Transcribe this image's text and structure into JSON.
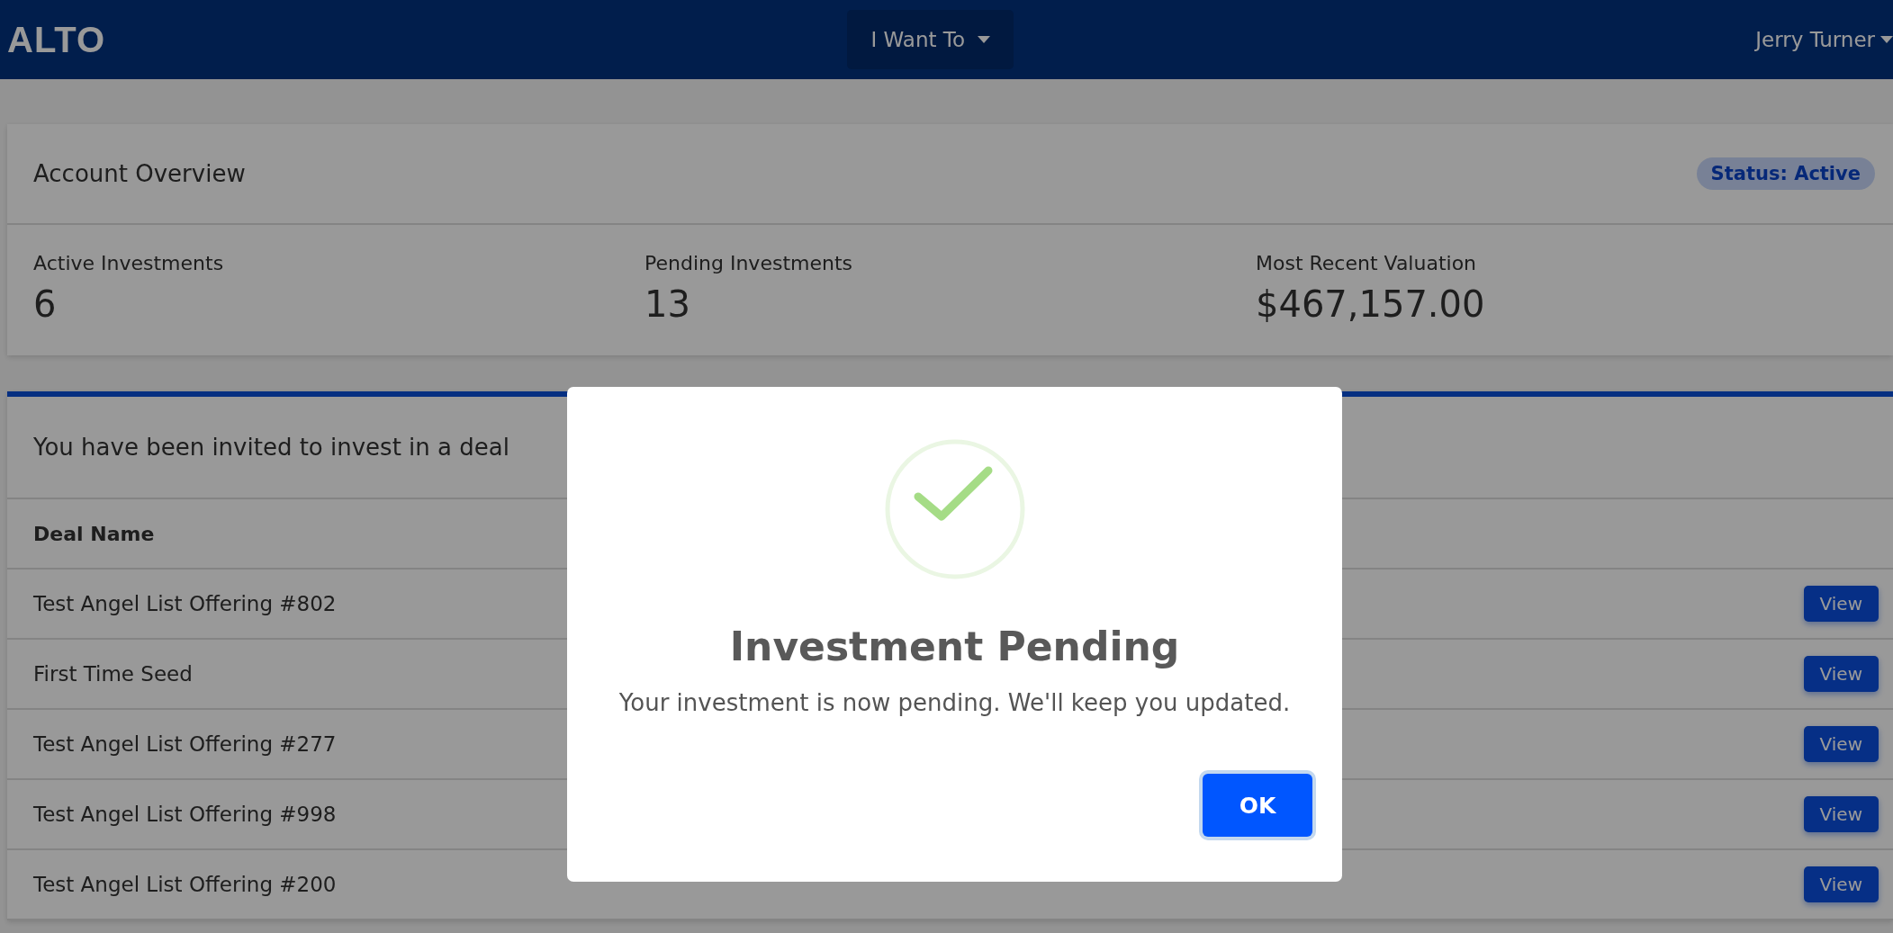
{
  "navbar": {
    "logo": "ALTO",
    "menu_button": "I Want To",
    "user_menu": "Jerry Turner"
  },
  "account_overview": {
    "title": "Account Overview",
    "status_badge": "Status: Active",
    "stats": [
      {
        "label": "Active Investments",
        "value": "6"
      },
      {
        "label": "Pending Investments",
        "value": "13"
      },
      {
        "label": "Most Recent Valuation",
        "value": "$467,157.00"
      }
    ]
  },
  "invitations": {
    "title": "You have been invited to invest in a deal",
    "columns": [
      "Deal Name"
    ],
    "rows": [
      {
        "deal_name": "Test Angel List Offering #802",
        "action": "View"
      },
      {
        "deal_name": "First Time Seed",
        "action": "View"
      },
      {
        "deal_name": "Test Angel List Offering #277",
        "action": "View"
      },
      {
        "deal_name": "Test Angel List Offering #998",
        "action": "View"
      },
      {
        "deal_name": "Test Angel List Offering #200",
        "action": "View"
      }
    ]
  },
  "dialog": {
    "title": "Investment Pending",
    "message": "Your investment is now pending. We'll keep you updated.",
    "button": "OK"
  }
}
